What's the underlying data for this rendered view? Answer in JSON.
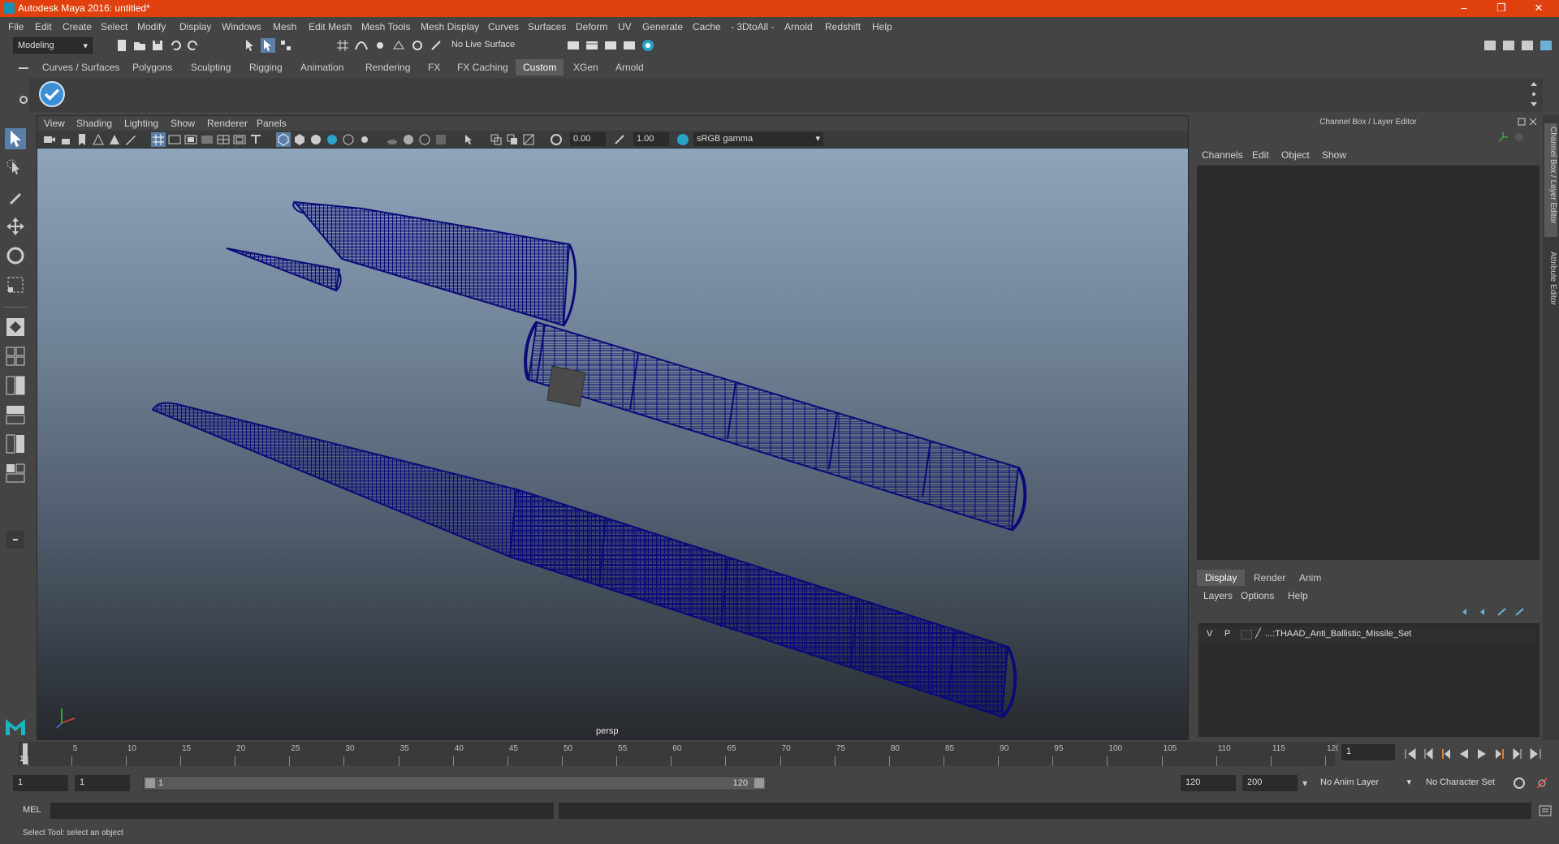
{
  "window": {
    "title": "Autodesk Maya 2016: untitled*",
    "minimize": "–",
    "maximize": "❐",
    "close": "✕"
  },
  "menubar": [
    "File",
    "Edit",
    "Create",
    "Select",
    "Modify",
    "Display",
    "Windows",
    "Mesh",
    "Edit Mesh",
    "Mesh Tools",
    "Mesh Display",
    "Curves",
    "Surfaces",
    "Deform",
    "UV",
    "Generate",
    "Cache",
    "- 3DtoAll -",
    "Arnold",
    "Redshift",
    "Help"
  ],
  "statusline": {
    "mode": "Modeling",
    "live_surface": "No Live Surface"
  },
  "shelf": {
    "tabs": [
      "Curves / Surfaces",
      "Polygons",
      "Sculpting",
      "Rigging",
      "Animation",
      "Rendering",
      "FX",
      "FX Caching",
      "Custom",
      "XGen",
      "Arnold"
    ],
    "active_tab": "Custom"
  },
  "viewport": {
    "menus": [
      "View",
      "Shading",
      "Lighting",
      "Show",
      "Renderer",
      "Panels"
    ],
    "exposure": "0.00",
    "gamma": "1.00",
    "color_space": "sRGB gamma",
    "camera_label": "persp"
  },
  "channel_box": {
    "title": "Channel Box / Layer Editor",
    "menus": [
      "Channels",
      "Edit",
      "Object",
      "Show"
    ],
    "layer_tabs": [
      "Display",
      "Render",
      "Anim"
    ],
    "active_layer_tab": "Display",
    "layer_menus": [
      "Layers",
      "Options",
      "Help"
    ],
    "layer": {
      "v": "V",
      "p": "P",
      "name": "...:THAAD_Anti_Ballistic_Missile_Set"
    },
    "side_tabs": [
      "Channel Box / Layer Editor",
      "Attribute Editor"
    ]
  },
  "timeline": {
    "tick_labels": [
      "5",
      "10",
      "15",
      "20",
      "25",
      "30",
      "35",
      "40",
      "45",
      "50",
      "55",
      "60",
      "65",
      "70",
      "75",
      "80",
      "85",
      "90",
      "95",
      "100",
      "105",
      "110",
      "115",
      "120"
    ],
    "current_frame_marker": "1",
    "current_frame": "1"
  },
  "range": {
    "start": "1",
    "playback_start": "1",
    "slider_start": "1",
    "slider_end": "120",
    "playback_end": "120",
    "end": "200",
    "anim_layer": "No Anim Layer",
    "character_set": "No Character Set"
  },
  "command_line": {
    "label": "MEL"
  },
  "help_line": {
    "text": "Select Tool: select an object"
  },
  "colors": {
    "title_bar": "#e0400e",
    "wireframe": "#0a0a78",
    "active_tab": "#5d5d5d"
  }
}
